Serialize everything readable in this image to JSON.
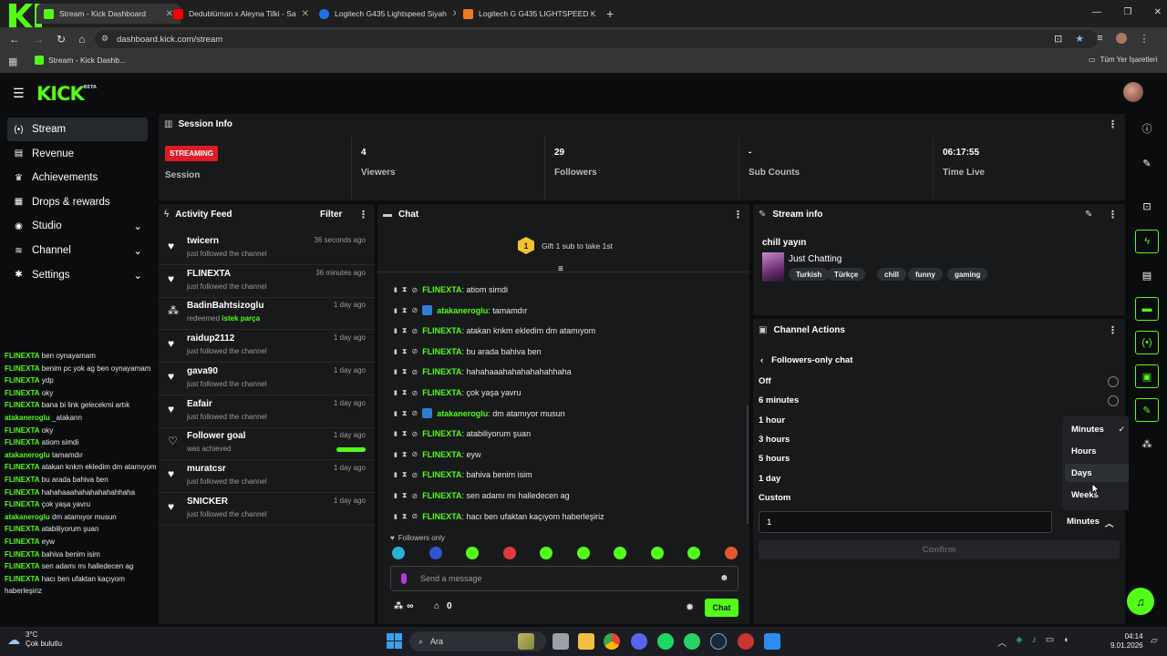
{
  "browser": {
    "tabs": [
      {
        "title": "Stream - Kick Dashboard",
        "color": "#53fc18"
      },
      {
        "title": "Dedublüman x Aleyna Tilki - Sa",
        "color": "#ff0000"
      },
      {
        "title": "Logitech G435 Lightspeed Siyah",
        "color": "#1a73e8"
      },
      {
        "title": "Logitech G G435 LIGHTSPEED K",
        "color": "#f27a1a"
      }
    ],
    "url": "dashboard.kick.com/stream",
    "bookmark": "Stream - Kick Dashb...",
    "all_bookmarks": "Tüm Yer İşaretleri",
    "overlay_text": "5"
  },
  "brand": {
    "logo": "KICK",
    "beta": "BETA",
    "accent": "#53fc18"
  },
  "nav": [
    {
      "label": "Stream",
      "icon": "broadcast-icon",
      "glyph": "(•)",
      "active": true
    },
    {
      "label": "Revenue",
      "icon": "revenue-icon",
      "glyph": "▤"
    },
    {
      "label": "Achievements",
      "icon": "trophy-icon",
      "glyph": "♛"
    },
    {
      "label": "Drops & rewards",
      "icon": "gift-icon",
      "glyph": "▦"
    },
    {
      "label": "Studio",
      "icon": "studio-icon",
      "glyph": "◉",
      "chevron": true
    },
    {
      "label": "Channel",
      "icon": "channel-icon",
      "glyph": "≋",
      "chevron": true
    },
    {
      "label": "Settings",
      "icon": "gear-icon",
      "glyph": "✱",
      "chevron": true
    }
  ],
  "chat_preview": [
    {
      "u": "FLINEXTA",
      "t": "ben oynayamam"
    },
    {
      "u": "FLINEXTA",
      "t": "benim pc yok ag ben oynayamam"
    },
    {
      "u": "FLINEXTA",
      "t": "ydp"
    },
    {
      "u": "FLINEXTA",
      "t": "oky"
    },
    {
      "u": "FLINEXTA",
      "t": "bana bi link gelecekmi artık"
    },
    {
      "u": "atakaneroglu",
      "t": "_atakann"
    },
    {
      "u": "FLINEXTA",
      "t": "oky"
    },
    {
      "u": "FLINEXTA",
      "t": "atiom simdi"
    },
    {
      "u": "atakaneroglu",
      "t": "tamamdır"
    },
    {
      "u": "FLINEXTA",
      "t": "atakan knkm ekledim dm atamıyom"
    },
    {
      "u": "FLINEXTA",
      "t": "bu arada bahiva ben"
    },
    {
      "u": "FLINEXTA",
      "t": "hahahaaahahahahahahhaha"
    },
    {
      "u": "FLINEXTA",
      "t": "çok yaşa yavru"
    },
    {
      "u": "atakaneroglu",
      "t": "dm atamıyor musun"
    },
    {
      "u": "FLINEXTA",
      "t": "atabiliyorum şuan"
    },
    {
      "u": "FLINEXTA",
      "t": "eyw"
    },
    {
      "u": "FLINEXTA",
      "t": "bahiva benim isim"
    },
    {
      "u": "FLINEXTA",
      "t": "sen adamı mı halledecen ag"
    },
    {
      "u": "FLINEXTA",
      "t": "hacı ben ufaktan kaçıyom haberleşiriz"
    }
  ],
  "session": {
    "title": "Session Info",
    "status": "STREAMING",
    "session_label": "Session",
    "stats": [
      {
        "value": "4",
        "label": "Viewers"
      },
      {
        "value": "29",
        "label": "Followers"
      },
      {
        "value": "-",
        "label": "Sub Counts"
      },
      {
        "value": "06:17:55",
        "label": "Time Live"
      }
    ]
  },
  "activity": {
    "title": "Activity Feed",
    "filter": "Filter",
    "items": [
      {
        "name": "twicern",
        "sub": "just followed the channel",
        "time": "36 seconds ago",
        "icon": "heart-icon",
        "glyph": "♥"
      },
      {
        "name": "FLINEXTA",
        "sub": "just followed the channel",
        "time": "36 minutes ago",
        "icon": "heart-icon",
        "glyph": "♥"
      },
      {
        "name": "BadinBahtsizoglu",
        "sub": "redeemed",
        "sub_hl": "istek parça",
        "time": "1 day ago",
        "icon": "points-icon",
        "glyph": "⁂"
      },
      {
        "name": "raidup2112",
        "sub": "just followed the channel",
        "time": "1 day ago",
        "icon": "heart-icon",
        "glyph": "♥"
      },
      {
        "name": "gava90",
        "sub": "just followed the channel",
        "time": "1 day ago",
        "icon": "heart-icon",
        "glyph": "♥"
      },
      {
        "name": "Eafair",
        "sub": "just followed the channel",
        "time": "1 day ago",
        "icon": "heart-icon",
        "glyph": "♥"
      },
      {
        "name": "Follower goal",
        "sub": "was achieved",
        "time": "1 day ago",
        "icon": "heart-outline-icon",
        "glyph": "♡",
        "goal_progress": 1.0
      },
      {
        "name": "muratcsr",
        "sub": "just followed the channel",
        "time": "1 day ago",
        "icon": "heart-icon",
        "glyph": "♥"
      },
      {
        "name": "SNICKER",
        "sub": "just followed the channel",
        "time": "1 day ago",
        "icon": "heart-icon",
        "glyph": "♥"
      }
    ]
  },
  "chat": {
    "title": "Chat",
    "gift": "Gift 1 sub to take 1st",
    "gift_rank": "1",
    "messages": [
      {
        "u": "FLINEXTA",
        "t": ": atiom simdi",
        "verified": false
      },
      {
        "u": "atakaneroglu",
        "t": ": tamamdır",
        "verified": true
      },
      {
        "u": "FLINEXTA",
        "t": ": atakan knkm ekledim dm atamıyom",
        "verified": false
      },
      {
        "u": "FLINEXTA",
        "t": ": bu arada bahiva ben",
        "verified": false
      },
      {
        "u": "FLINEXTA",
        "t": ": hahahaaahahahahahahhaha",
        "verified": false
      },
      {
        "u": "FLINEXTA",
        "t": ": çok yaşa yavru",
        "verified": false
      },
      {
        "u": "atakaneroglu",
        "t": ": dm atamıyor musun",
        "verified": true
      },
      {
        "u": "FLINEXTA",
        "t": ": atabiliyorum şuan",
        "verified": false
      },
      {
        "u": "FLINEXTA",
        "t": ": eyw",
        "verified": false
      },
      {
        "u": "FLINEXTA",
        "t": ": bahiva benim isim",
        "verified": false
      },
      {
        "u": "FLINEXTA",
        "t": ": sen adamı mı halledecen ag",
        "verified": false
      },
      {
        "u": "FLINEXTA",
        "t": ": hacı ben ufaktan kaçıyom haberleşiriz",
        "verified": false
      }
    ],
    "followers_only": "Followers only",
    "placeholder": "Send a message",
    "points": "∞",
    "count": "0",
    "send": "Chat"
  },
  "stream_info": {
    "title": "Stream info",
    "stream_title": "chill yayın",
    "category": "Just Chatting",
    "tags": [
      "Turkish",
      "Türkçe",
      "chill",
      "funny",
      "gaming"
    ]
  },
  "channel_actions": {
    "title": "Channel Actions",
    "back": "Followers-only chat",
    "options": [
      "Off",
      "6 minutes",
      "1 hour",
      "3 hours",
      "5 hours",
      "1 day",
      "Custom"
    ],
    "custom_value": "1",
    "unit": "Minutes",
    "confirm": "Confirm",
    "dropdown": [
      "Minutes",
      "Hours",
      "Days",
      "Weeks"
    ],
    "dropdown_selected": "Minutes",
    "dropdown_hover": "Days"
  },
  "taskbar": {
    "weather_temp": "3°C",
    "weather_desc": "Çok bulutlu",
    "search": "Ara",
    "time": "04:14",
    "date": "9.01.2026"
  }
}
